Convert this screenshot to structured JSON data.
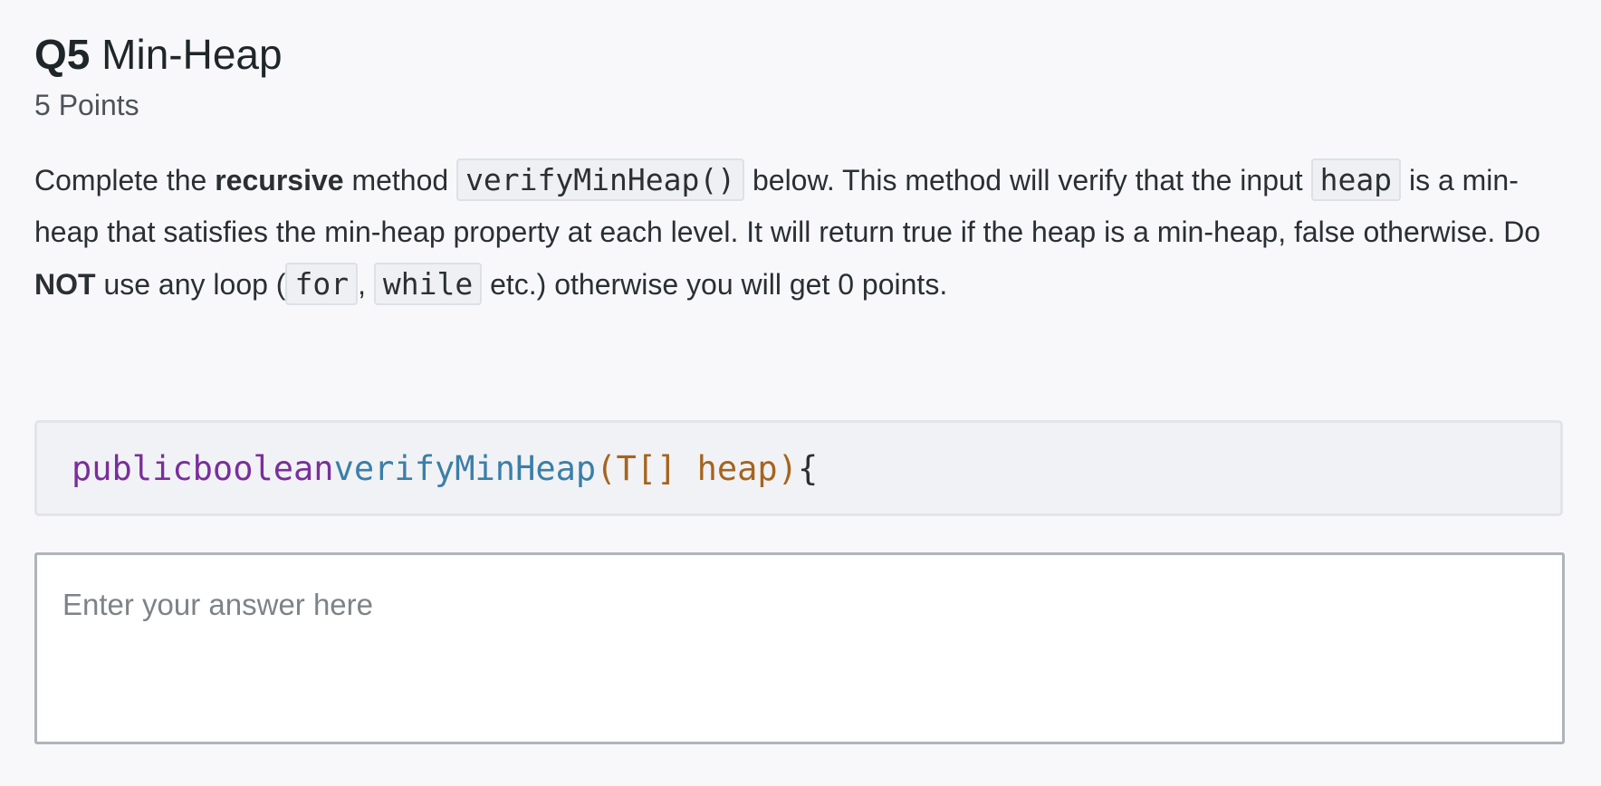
{
  "question": {
    "number": "Q5",
    "title": "Min-Heap",
    "points": "5 Points",
    "prompt": {
      "p1": "Complete the ",
      "bold1": "recursive",
      "p2": " method ",
      "code1": "verifyMinHeap()",
      "p3": " below. This method will verify that the input ",
      "code2": "heap",
      "p4": " is a min-heap that satisfies the min-heap property at each level. It will return true if the heap is a min-heap, false otherwise. Do ",
      "bold2": "NOT",
      "p5": " use any loop (",
      "code3": "for",
      "p6": ", ",
      "code4": "while",
      "p7": " etc.) otherwise you will get 0 points."
    }
  },
  "code_block": {
    "kw_public": "public",
    "kw_boolean": "boolean",
    "fn_name": "verifyMinHeap",
    "paren_open": "(",
    "param": "T[] heap",
    "paren_close": ")",
    "brace": "{"
  },
  "answer": {
    "value": "",
    "placeholder": "Enter your answer here"
  },
  "colors": {
    "keyword": "#7a2e9c",
    "function": "#3a7fa8",
    "parameter": "#a5641f"
  }
}
